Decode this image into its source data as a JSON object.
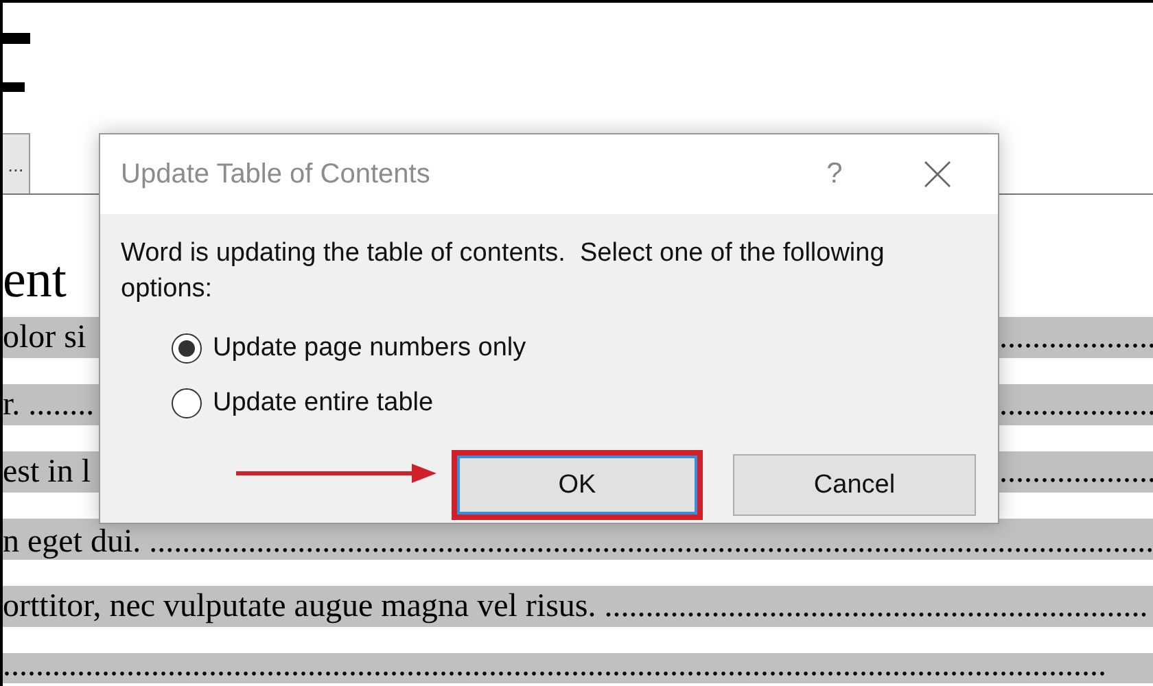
{
  "document": {
    "more_button": "...",
    "heading": "ent",
    "toc_rows": [
      {
        "left": "olor si",
        "right": "..................."
      },
      {
        "left": "r. ........",
        "right": "..................."
      },
      {
        "left": "est in l",
        "right": "..................."
      },
      {
        "left": "n eget dui. ..........................................................................................................................",
        "right": ""
      },
      {
        "left": "orttitor, nec vulputate augue magna vel risus. ..................................................................",
        "right": ""
      },
      {
        "left": "......................................................................................................................................",
        "right": ""
      }
    ]
  },
  "dialog": {
    "title": "Update Table of Contents",
    "help": "?",
    "message": "Word is updating the table of contents.  Select one of the following options:",
    "options": [
      {
        "label": "Update page numbers only",
        "selected": true
      },
      {
        "label": "Update entire table",
        "selected": false
      }
    ],
    "buttons": [
      {
        "label": "OK",
        "default": true,
        "highlighted": true
      },
      {
        "label": "Cancel",
        "default": false,
        "highlighted": false
      }
    ]
  },
  "annotation": {
    "kind": "arrow"
  }
}
